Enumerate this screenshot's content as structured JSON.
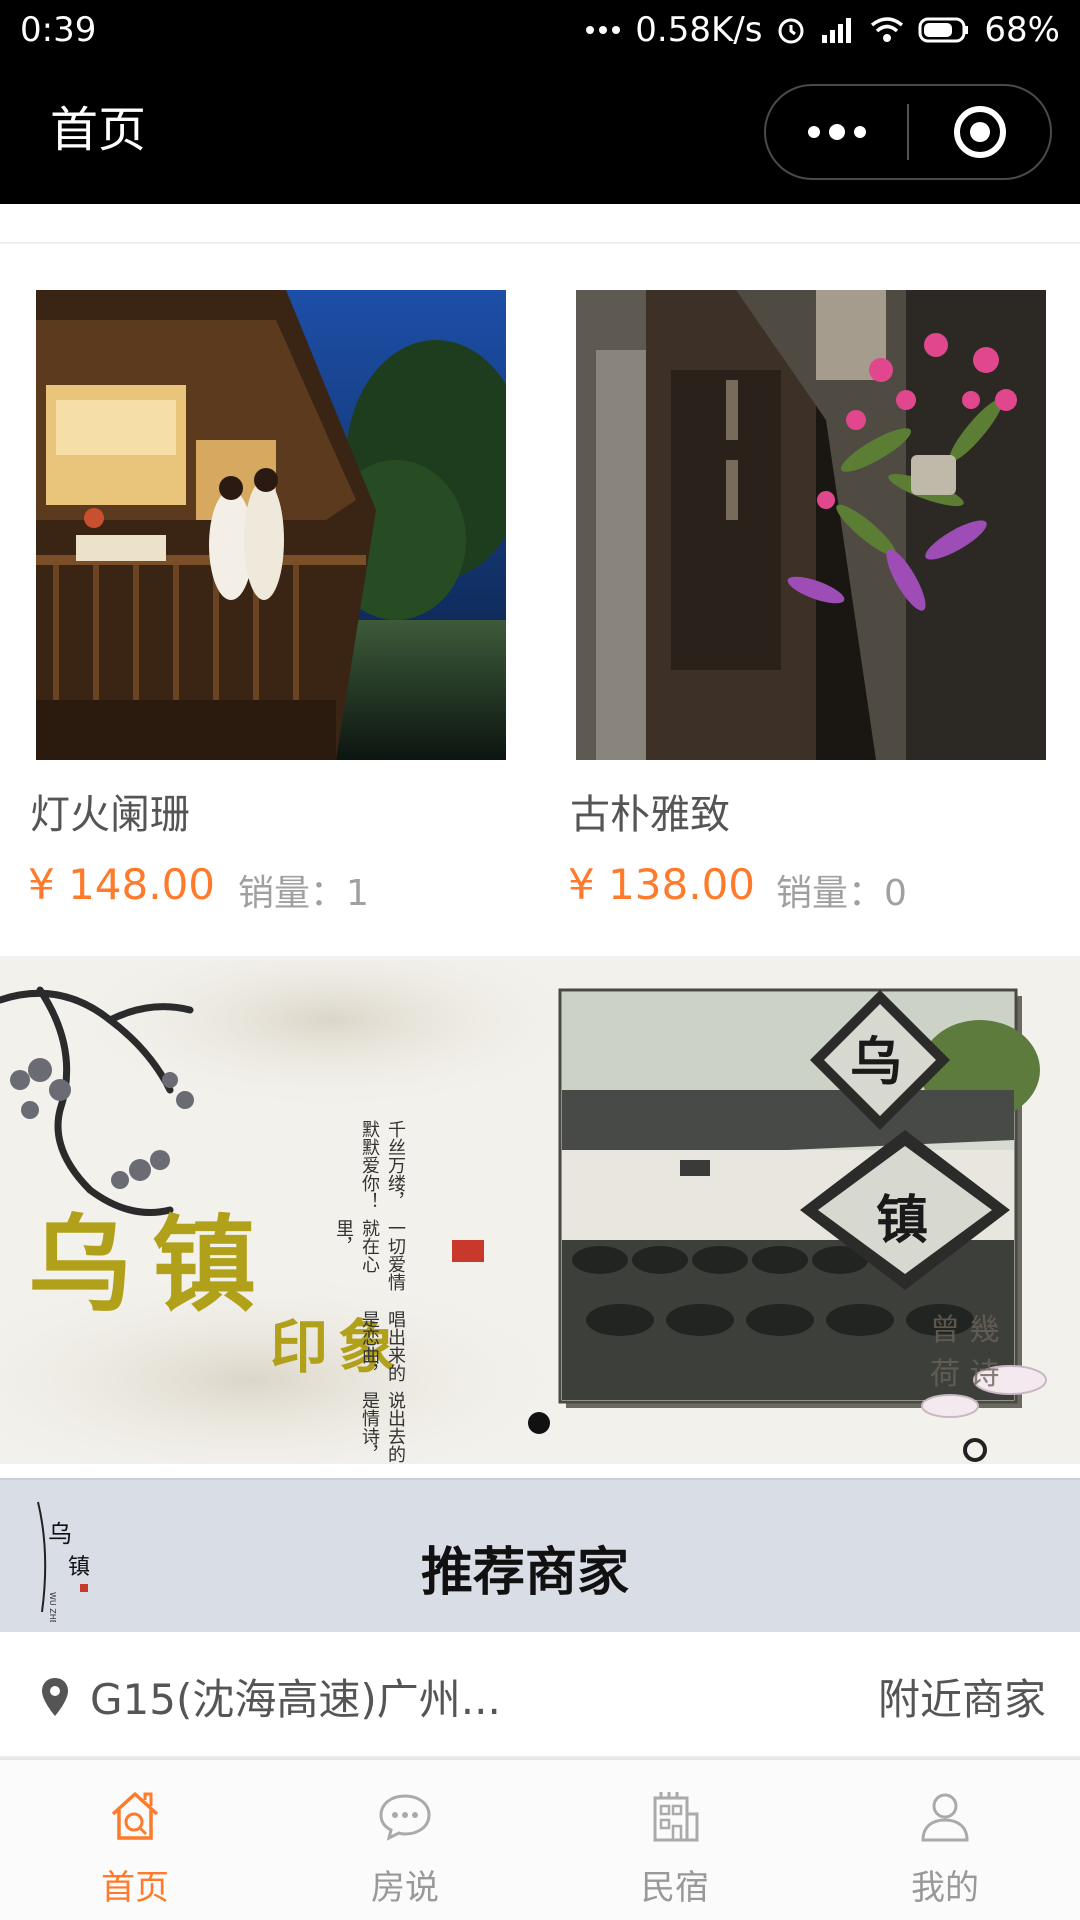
{
  "status_bar": {
    "time": "0:39",
    "network_speed": "0.58K/s",
    "battery": "68%",
    "icons": [
      "more-dots-icon",
      "alarm-icon",
      "signal-icon",
      "wifi-icon",
      "battery-icon"
    ]
  },
  "nav": {
    "title": "首页",
    "icons": [
      "more-icon",
      "close-target-icon"
    ]
  },
  "products": [
    {
      "name": "灯火阑珊",
      "price": "¥ 148.00",
      "sales_label": "销量：",
      "sales": "1"
    },
    {
      "name": "古朴雅致",
      "price": "¥ 138.00",
      "sales_label": "销量：",
      "sales": "0"
    }
  ],
  "banner": {
    "title": "乌镇",
    "subtitle": "印象",
    "poem": [
      "说出去的是情诗，",
      "唱出来的是恋曲，",
      "一切爱情就在心里，",
      "千丝万缕，默默爱你！"
    ],
    "sign_top": "乌",
    "sign_bottom": "镇",
    "side_text": "曾 幾 荷 诗",
    "active_slide": 1
  },
  "merchant": {
    "title": "推荐商家",
    "logo_text": "乌镇",
    "logo_sub": "WU ZHEN"
  },
  "location": {
    "text": "G15(沈海高速)广州...",
    "nearby": "附近商家"
  },
  "tabs": [
    {
      "label": "首页",
      "icon": "home-icon",
      "active": true
    },
    {
      "label": "房说",
      "icon": "chat-icon",
      "active": false
    },
    {
      "label": "民宿",
      "icon": "building-icon",
      "active": false
    },
    {
      "label": "我的",
      "icon": "user-icon",
      "active": false
    }
  ],
  "colors": {
    "accent": "#ff7a2a",
    "nav_bg": "#000000",
    "merchant_bg": "#d9dde6"
  }
}
